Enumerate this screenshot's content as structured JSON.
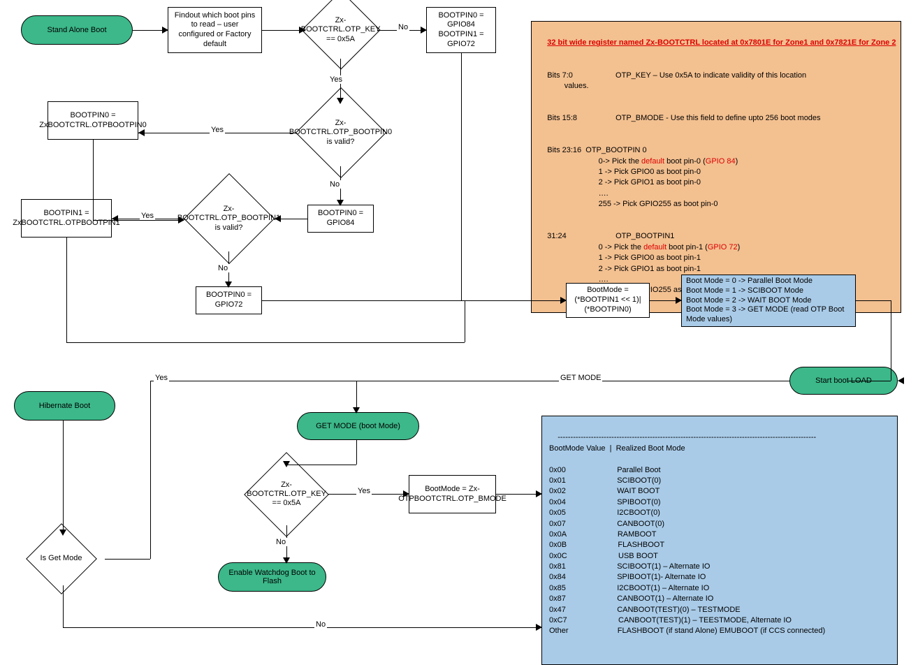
{
  "nodes": {
    "standAlone": "Stand Alone Boot",
    "findPins": "Findout which boot pins to read – user configured or Factory default",
    "d_key1": "Zx-BOOTCTRL.OTP_KEY == 0x5A",
    "defPins": "BOOTPIN0 = GPIO84\nBOOTPIN1 = GPIO72",
    "bp0otp": "BOOTPIN0 = ZxBOOTCTRL.OTPBOOTPIN0",
    "d_bp0valid": "Zx-BOOTCTRL.OTP_BOOTPIN0 is valid?",
    "bp0def": "BOOTPIN0 = GPIO84",
    "d_bp1valid": "Zx-BOOTCTRL.OTP_BOOTPIN1 is valid?",
    "bp1otp": "BOOTPIN1 = ZxBOOTCTRL.OTPBOOTPIN1",
    "bp1def": "BOOTPIN0 = GPIO72",
    "bootmodeCalc": "BootMode = (*BOOTPIN1 << 1)|(*BOOTPIN0)",
    "modeList": "Boot Mode = 0   -> Parallel Boot Mode\nBoot Mode = 1  -> SCIBOOT Mode\nBoot Mode = 2 -> WAIT BOOT Mode\nBoot Mode = 3 -> GET MODE (read OTP Boot Mode values)",
    "startLoad": "Start boot LOAD",
    "hibernate": "Hibernate Boot",
    "getModeTerm": "GET MODE (boot Mode)",
    "d_key2": "Zx-BOOTCTRL.OTP_KEY == 0x5A",
    "bmodeOtp": "BootMode = Zx-OTPBOOTCTRL.OTP_BMODE",
    "wdFlash": "Enable Watchdog Boot to Flash",
    "d_isGetMode": "Is Get Mode"
  },
  "labels": {
    "yes": "Yes",
    "no": "No",
    "getmode": "GET MODE"
  },
  "noteReg": {
    "title": "32 bit wide register named Zx-BOOTCTRL located at 0x7801E for Zone1 and 0x7821E for Zone 2",
    "r1a": "Bits 7:0",
    "r1b": "OTP_KEY – Use 0x5A to indicate validity of this location",
    "r1c": "values.",
    "r2a": "Bits 15:8",
    "r2b": "OTP_BMODE - Use this field to define upto 256 boot modes",
    "r3a": "Bits 23:16  OTP_BOOTPIN 0",
    "r3b": "0-> Pick the ",
    "r3c": "default",
    "r3d": " boot pin-0 (",
    "r3e": "GPIO 84",
    "r3f": ")",
    "r3g": "1 -> Pick GPIO0 as boot pin-0",
    "r3h": "2 -> Pick GPIO1 as boot pin-0",
    "r3i": "….",
    "r3j": "255 -> Pick GPIO255 as boot pin-0",
    "r4a": "31:24",
    "r4b": "OTP_BOOTPIN1",
    "r4c": "0 -> Pick the ",
    "r4d": "default",
    "r4e": " boot pin-1 (",
    "r4f": "GPIO 72",
    "r4g": ")",
    "r4h": "1 -> Pick GPIO0 as boot pin-1",
    "r4i": "2 -> Pick GPIO1 as boot pin-1",
    "r4j": "….",
    "r4k": "255 -> Pick GPIO255 as boot pin-1"
  },
  "noteModes": {
    "sep": "-----------------------------------------------------------------------------------------------------",
    "hdr": "BootMode Value  |  Realized Boot Mode",
    "rows": [
      [
        "0x00",
        "Parallel Boot"
      ],
      [
        "0x01",
        "SCIBOOT(0)"
      ],
      [
        "0x02",
        "WAIT BOOT"
      ],
      [
        "0x04",
        "SPIBOOT(0)"
      ],
      [
        "0x05",
        "I2CBOOT(0)"
      ],
      [
        "0x07",
        "CANBOOT(0)"
      ],
      [
        "0x0A",
        "RAMBOOT"
      ],
      [
        "0x0B",
        "FLASHBOOT"
      ],
      [
        "0x0C",
        "USB BOOT"
      ],
      [
        "0x81",
        "SCIBOOT(1) – Alternate IO"
      ],
      [
        "0x84",
        "SPIBOOT(1)- Alternate IO"
      ],
      [
        "0x85",
        "I2CBOOT(1) – Alternate IO"
      ],
      [
        "0x87",
        "CANBOOT(1) – Alternate IO"
      ],
      [
        "0x47",
        "CANBOOT(TEST)(0) – TESTMODE"
      ],
      [
        "0xC7",
        "CANBOOT(TEST)(1) – TEESTMODE, Alternate IO"
      ],
      [
        "Other",
        "FLASHBOOT (if stand Alone) EMUBOOT (if CCS connected)"
      ]
    ]
  },
  "chart_data": {
    "type": "flowchart",
    "nodes": [
      {
        "id": "standAlone",
        "kind": "terminal",
        "text": "Stand Alone Boot"
      },
      {
        "id": "findPins",
        "kind": "process",
        "text": "Findout which boot pins to read – user configured or Factory default"
      },
      {
        "id": "d_key1",
        "kind": "decision",
        "text": "Zx-BOOTCTRL.OTP_KEY == 0x5A"
      },
      {
        "id": "defPins",
        "kind": "process",
        "text": "BOOTPIN0 = GPIO84; BOOTPIN1 = GPIO72"
      },
      {
        "id": "d_bp0valid",
        "kind": "decision",
        "text": "Zx-BOOTCTRL.OTP_BOOTPIN0 is valid?"
      },
      {
        "id": "bp0otp",
        "kind": "process",
        "text": "BOOTPIN0 = ZxBOOTCTRL.OTPBOOTPIN0"
      },
      {
        "id": "bp0def",
        "kind": "process",
        "text": "BOOTPIN0 = GPIO84"
      },
      {
        "id": "d_bp1valid",
        "kind": "decision",
        "text": "Zx-BOOTCTRL.OTP_BOOTPIN1 is valid?"
      },
      {
        "id": "bp1otp",
        "kind": "process",
        "text": "BOOTPIN1 = ZxBOOTCTRL.OTPBOOTPIN1"
      },
      {
        "id": "bp1def",
        "kind": "process",
        "text": "BOOTPIN0 = GPIO72"
      },
      {
        "id": "bootmodeCalc",
        "kind": "process",
        "text": "BootMode = (*BOOTPIN1 << 1)|(*BOOTPIN0)"
      },
      {
        "id": "modeList",
        "kind": "annotation",
        "text": "Boot Mode 0..3 (Parallel/SCIBOOT/WAIT/GET MODE)"
      },
      {
        "id": "startLoad",
        "kind": "terminal",
        "text": "Start boot LOAD"
      },
      {
        "id": "hibernate",
        "kind": "terminal",
        "text": "Hibernate Boot"
      },
      {
        "id": "d_isGetMode",
        "kind": "decision",
        "text": "Is Get Mode"
      },
      {
        "id": "getModeTerm",
        "kind": "terminal",
        "text": "GET MODE (boot Mode)"
      },
      {
        "id": "d_key2",
        "kind": "decision",
        "text": "Zx-BOOTCTRL.OTP_KEY == 0x5A"
      },
      {
        "id": "bmodeOtp",
        "kind": "process",
        "text": "BootMode = Zx-OTPBOOTCTRL.OTP_BMODE"
      },
      {
        "id": "wdFlash",
        "kind": "terminal",
        "text": "Enable Watchdog Boot to Flash"
      },
      {
        "id": "noteReg",
        "kind": "annotation",
        "text": "Zx-BOOTCTRL register description"
      },
      {
        "id": "noteModes",
        "kind": "annotation",
        "text": "BootMode value table"
      }
    ],
    "edges": [
      {
        "from": "standAlone",
        "to": "findPins"
      },
      {
        "from": "findPins",
        "to": "d_key1"
      },
      {
        "from": "d_key1",
        "to": "defPins",
        "label": "No"
      },
      {
        "from": "d_key1",
        "to": "d_bp0valid",
        "label": "Yes"
      },
      {
        "from": "d_bp0valid",
        "to": "bp0otp",
        "label": "Yes"
      },
      {
        "from": "d_bp0valid",
        "to": "bp0def",
        "label": "No"
      },
      {
        "from": "bp0otp",
        "to": "d_bp1valid"
      },
      {
        "from": "bp0def",
        "to": "d_bp1valid"
      },
      {
        "from": "d_bp1valid",
        "to": "bp1otp",
        "label": "Yes"
      },
      {
        "from": "d_bp1valid",
        "to": "bp1def",
        "label": "No"
      },
      {
        "from": "defPins",
        "to": "bootmodeCalc"
      },
      {
        "from": "bp1otp",
        "to": "bootmodeCalc"
      },
      {
        "from": "bp1def",
        "to": "bootmodeCalc"
      },
      {
        "from": "bootmodeCalc",
        "to": "modeList"
      },
      {
        "from": "modeList",
        "to": "startLoad"
      },
      {
        "from": "startLoad",
        "to": "getModeTerm",
        "label": "GET MODE"
      },
      {
        "from": "hibernate",
        "to": "d_isGetMode"
      },
      {
        "from": "d_isGetMode",
        "to": "getModeTerm",
        "label": "Yes"
      },
      {
        "from": "d_isGetMode",
        "to": "noteModes",
        "label": "No"
      },
      {
        "from": "getModeTerm",
        "to": "d_key2"
      },
      {
        "from": "d_key2",
        "to": "bmodeOtp",
        "label": "Yes"
      },
      {
        "from": "d_key2",
        "to": "wdFlash",
        "label": "No"
      },
      {
        "from": "bmodeOtp",
        "to": "noteModes"
      }
    ]
  }
}
